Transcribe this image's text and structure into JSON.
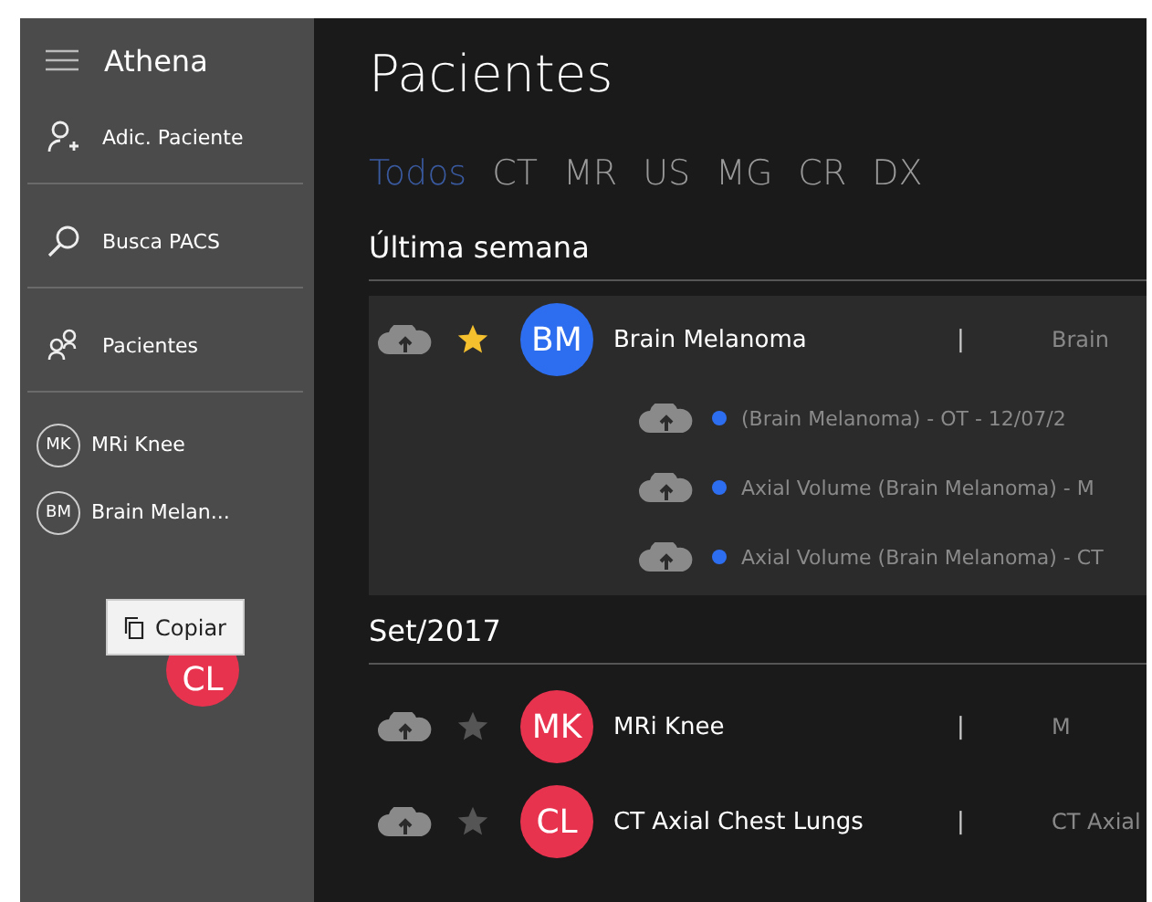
{
  "sidebar": {
    "title": "Athena",
    "items": [
      {
        "label": "Adic. Paciente",
        "kind": "add"
      },
      {
        "label": "Busca PACS",
        "kind": "search"
      },
      {
        "label": "Pacientes",
        "kind": "people"
      }
    ],
    "recent": [
      {
        "initials": "MK",
        "label": "MRi Knee"
      },
      {
        "initials": "BM",
        "label": "Brain Melan..."
      }
    ],
    "drag_avatar": {
      "initials": "CL",
      "color": "#e8334f"
    },
    "tooltip": {
      "label": "Copiar"
    }
  },
  "page": {
    "title": "Pacientes",
    "tabs": [
      {
        "label": "Todos",
        "selected": true
      },
      {
        "label": "CT",
        "selected": false
      },
      {
        "label": "MR",
        "selected": false
      },
      {
        "label": "US",
        "selected": false
      },
      {
        "label": "MG",
        "selected": false
      },
      {
        "label": "CR",
        "selected": false
      },
      {
        "label": "DX",
        "selected": false
      }
    ],
    "groups": [
      {
        "heading": "Última semana",
        "kind": "panel",
        "patients": [
          {
            "initials": "BM",
            "color": "#2d6ef0",
            "name": "Brain Melanoma",
            "starred": true,
            "separator": "|",
            "detail": "Brain",
            "studies": [
              {
                "text": "(Brain Melanoma)  -  OT  -  12/07/2",
                "color": "#2d6ef0"
              },
              {
                "text": "Axial Volume (Brain Melanoma)  -  M",
                "color": "#2d6ef0"
              },
              {
                "text": "Axial Volume (Brain Melanoma)  -  CT",
                "color": "#2d6ef0"
              }
            ]
          }
        ]
      },
      {
        "heading": "Set/2017",
        "kind": "list",
        "patients": [
          {
            "initials": "MK",
            "color": "#e8334f",
            "name": "MRi Knee",
            "starred": false,
            "separator": "|",
            "detail": "M"
          },
          {
            "initials": "CL",
            "color": "#e8334f",
            "name": "CT Axial Chest Lungs",
            "starred": false,
            "separator": "|",
            "detail": "CT Axial"
          }
        ]
      }
    ]
  }
}
